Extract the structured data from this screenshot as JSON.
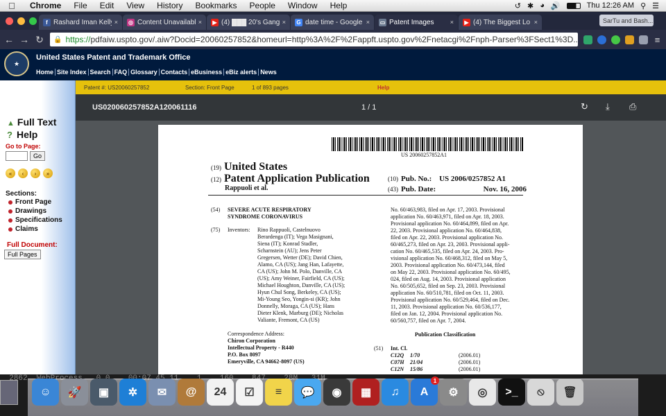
{
  "menubar": {
    "app": "Chrome",
    "items": [
      "File",
      "Edit",
      "View",
      "History",
      "Bookmarks",
      "People",
      "Window",
      "Help"
    ],
    "clock": "Thu 12:26 AM"
  },
  "tabs": [
    {
      "favicon": "f",
      "color": "#3b5998",
      "title": "Rashard Iman Kelly"
    },
    {
      "favicon": "◎",
      "color": "#c13584",
      "title": "Content Unavailable"
    },
    {
      "favicon": "▶",
      "color": "#e62117",
      "title": "(4) ███ 20's Gang"
    },
    {
      "favicon": "G",
      "color": "#4285f4",
      "title": "date time - Google S"
    },
    {
      "favicon": "▭",
      "color": "#6b7a90",
      "title": "Patent Images",
      "active": true
    },
    {
      "favicon": "▶",
      "color": "#e62117",
      "title": "(4) The Biggest Lo"
    }
  ],
  "profile_tab": "SarTu and Bash...",
  "address": {
    "scheme": "https://",
    "rest": "pdfaiw.uspto.gov/.aiw?Docid=20060257852&homeurl=http%3A%2F%2Fappft.uspto.gov%2Fnetacgi%2Fnph-Parser%3FSect1%3D..."
  },
  "uspto": {
    "title": "United States Patent and Trademark Office",
    "links": [
      "Home",
      "Site Index",
      "Search",
      "FAQ",
      "Glossary",
      "Contacts",
      "eBusiness",
      "eBiz alerts",
      "News"
    ]
  },
  "leftnav": {
    "full_text": "Full Text",
    "help": "Help",
    "go_to_page": "Go to Page:",
    "go": "Go",
    "sections_title": "Sections:",
    "sections": [
      "Front Page",
      "Drawings",
      "Specifications",
      "Claims"
    ],
    "full_document": "Full Document:",
    "full_pages": "Full Pages"
  },
  "infobar": {
    "patent": "Patent #: US20060257852",
    "section": "Section: Front Page",
    "pages": "1 of 893 pages",
    "help": "Help"
  },
  "viewer": {
    "doc_name": "US020060257852A120061116",
    "page_indicator": "1 / 1"
  },
  "doc": {
    "barcode_text": "US 20060257852A1",
    "n19": "(19)",
    "country": "United States",
    "n12": "(12)",
    "kind": "Patent Application Publication",
    "author": "Rappuoli et al.",
    "n10": "(10)",
    "pub_no_label": "Pub. No.:",
    "pub_no": "US 2006/0257852 A1",
    "n43": "(43)",
    "pub_date_label": "Pub. Date:",
    "pub_date": "Nov. 16, 2006",
    "n54": "(54)",
    "title_l1": "SEVERE ACUTE RESPIRATORY",
    "title_l2": "SYNDROME CORONAVIRUS",
    "n75": "(75)",
    "inventors_label": "Inventors:",
    "inventors": [
      "Rino Rappuoli, Castelnuovo",
      "Berardenga (IT); Vega Masignani,",
      "Siena (IT); Konrad Stadler,",
      "Scharnstein (AU); Jens Peter",
      "Gregersen, Wetter (DE); David Chien,",
      "Alamo, CA (US); Jang Han, Lafayette,",
      "CA (US); John M. Polo, Danville, CA",
      "(US); Amy Weiner, Fairfield, CA (US);",
      "Michael Houghton, Danville, CA (US);",
      "Hyun Chul Song, Berkeley, CA (US);",
      "Mi-Young Seo, Yongin-si (KR); John",
      "Donnelly, Moraga, CA (US); Hans",
      "Dieter Klenk, Marburg (DE); Nicholas",
      "Valiante, Fremont, CA (US)"
    ],
    "corr_label": "Correspondence Address:",
    "corr": [
      "Chiron Corporation",
      "Intellectual Property - R440",
      "P.O. Box 8097",
      "Emeryville, CA 94662-8097 (US)"
    ],
    "right_col": [
      "No. 60/463,983, filed on Apr. 17, 2003. Provisional",
      "application No. 60/463,971, filed on Apr. 18, 2003.",
      "Provisional application No. 60/464,899, filed on Apr.",
      "22, 2003. Provisional application No. 60/464,838,",
      "filed on Apr. 22, 2003. Provisional application No.",
      "60/465,273, filed on Apr. 23, 2003. Provisional appli-",
      "cation No. 60/465,535, filed on Apr. 24, 2003. Pro-",
      "visional application No. 60/468,312, filed on May 5,",
      "2003. Provisional application No. 60/473,144, filed",
      "on May 22, 2003. Provisional application No. 60/495,",
      "024, filed on Aug. 14, 2003. Provisional application",
      "No. 60/505,652, filed on Sep. 23, 2003. Provisional",
      "application No. 60/510,781, filed on Oct. 11, 2003.",
      "Provisional application No. 60/529,464, filed on Dec.",
      "11, 2003. Provisional application No. 60/536,177,",
      "filed on Jan. 12, 2004. Provisional application No.",
      "60/560,757, filed on Apr. 7, 2004."
    ],
    "pub_class": "Publication Classification",
    "n51": "(51)",
    "int_cl": "Int. Cl.",
    "classes": [
      {
        "code": "C12Q",
        "grp": "1/70",
        "ver": "(2006.01)"
      },
      {
        "code": "C07H",
        "grp": "21/04",
        "ver": "(2006.01)"
      },
      {
        "code": "C12N",
        "grp": "15/86",
        "ver": "(2006.01)"
      }
    ]
  },
  "terminal_line": "  2862  WebProcess   0.0    00:07.45 11    1    160    847    28M   31M",
  "dock": [
    {
      "name": "finder",
      "color": "#3a86d6",
      "glyph": "☺"
    },
    {
      "name": "launchpad",
      "color": "#8a8f99",
      "glyph": "🚀"
    },
    {
      "name": "photo-booth",
      "color": "#4a5a6a",
      "glyph": "▣"
    },
    {
      "name": "safari",
      "color": "#1e7fd6",
      "glyph": "✲"
    },
    {
      "name": "mail-stamp",
      "color": "#7a8fb0",
      "glyph": "✉"
    },
    {
      "name": "contacts",
      "color": "#b07a3a",
      "glyph": "@"
    },
    {
      "name": "calendar",
      "color": "#f2f2f2",
      "glyph": "24"
    },
    {
      "name": "reminders",
      "color": "#f4f4f4",
      "glyph": "☑"
    },
    {
      "name": "notes",
      "color": "#f1d44a",
      "glyph": "≡"
    },
    {
      "name": "messages",
      "color": "#4aa8f0",
      "glyph": "💬"
    },
    {
      "name": "facetime",
      "color": "#3a3a3a",
      "glyph": "◉"
    },
    {
      "name": "photos",
      "color": "#b02020",
      "glyph": "▦"
    },
    {
      "name": "itunes",
      "color": "#2a8ae0",
      "glyph": "♫"
    },
    {
      "name": "app-store",
      "color": "#2a7ad8",
      "glyph": "A",
      "badge": "1"
    },
    {
      "name": "system-preferences",
      "color": "#8a8a8a",
      "glyph": "⚙"
    },
    {
      "name": "chrome",
      "color": "#e8e8e8",
      "glyph": "◎"
    },
    {
      "name": "terminal",
      "color": "#111111",
      "glyph": ">_"
    },
    {
      "name": "no-entry",
      "color": "#d8d8d8",
      "glyph": "⦸"
    },
    {
      "name": "trash",
      "color": "#c8c8c8",
      "glyph": "🗑"
    }
  ]
}
